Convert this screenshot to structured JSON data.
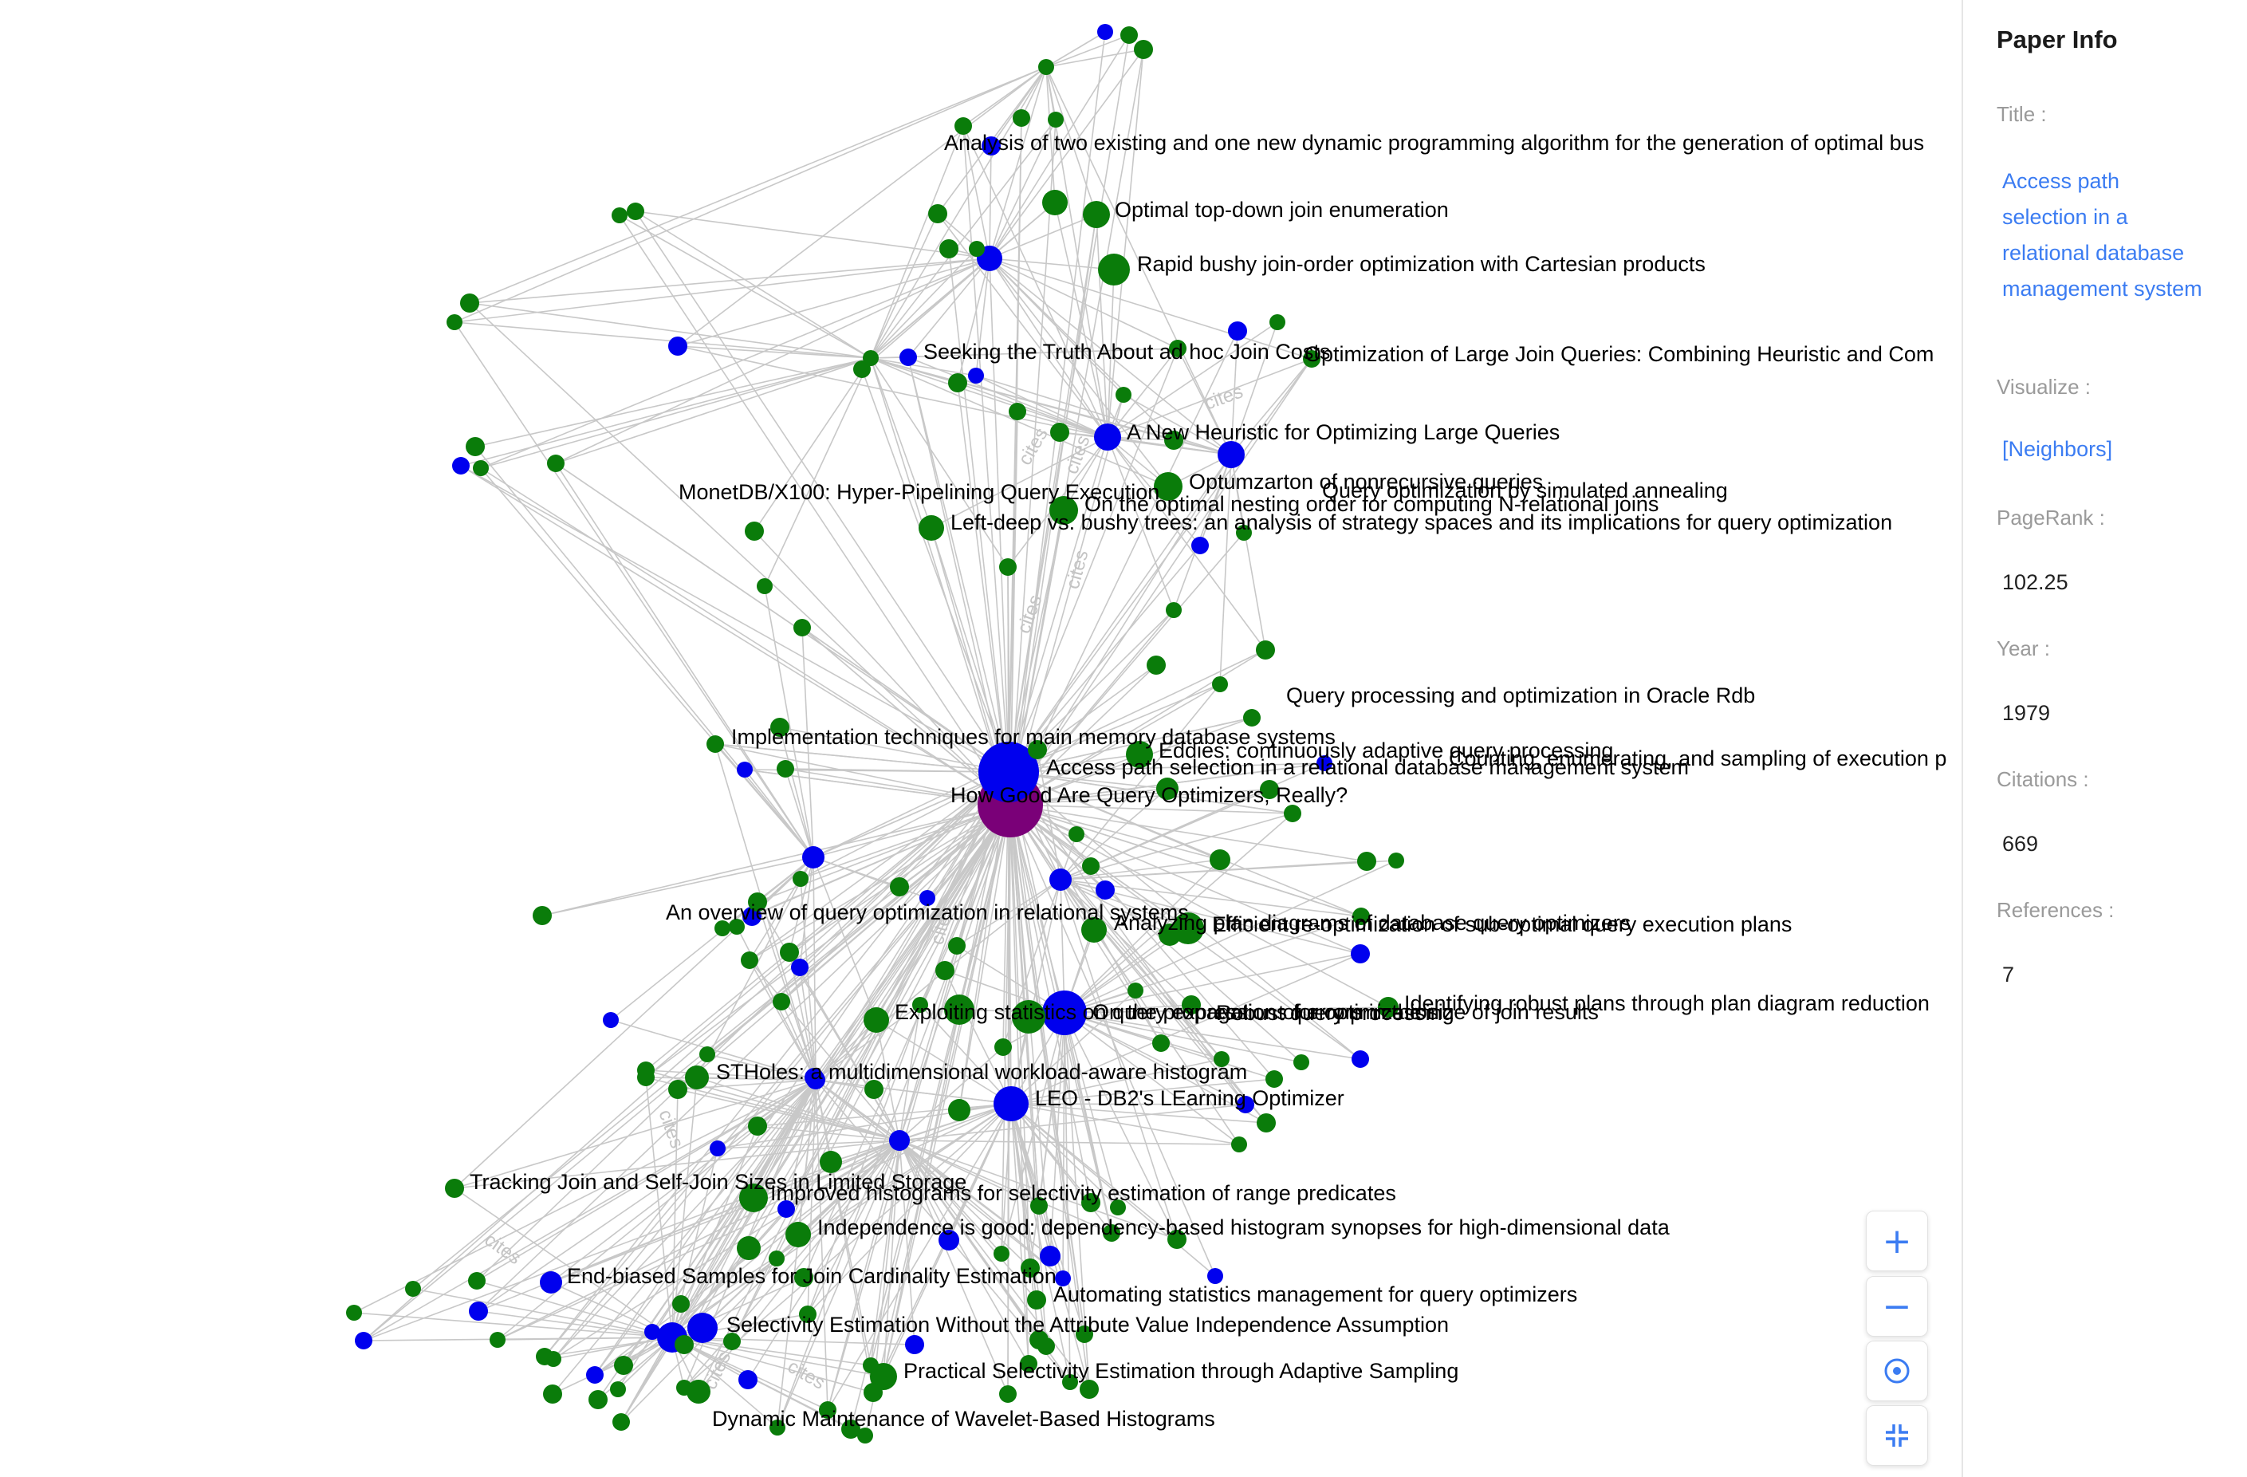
{
  "panel": {
    "title": "Paper Info",
    "title_label": "Title :",
    "paper_title": "Access path selection in a relational database management system",
    "visualize_label": "Visualize :",
    "visualize_link": "[Neighbors]",
    "pagerank_label": "PageRank :",
    "pagerank_value": "102.25",
    "year_label": "Year :",
    "year_value": "1979",
    "citations_label": "Citations :",
    "citations_value": "669",
    "references_label": "References :",
    "references_value": "7"
  },
  "controls": {
    "zoom_in": "+",
    "zoom_out": "−",
    "center": "⊙",
    "collapse": "⤡"
  },
  "colors": {
    "green": "#0a7c0a",
    "blue": "#0000ee",
    "purple": "#7a0078",
    "edge": "#c8c8c8",
    "accent": "#3b7cf2"
  },
  "edge_label_text": "cites",
  "labels": {
    "l1": "Analysis of two existing and one new dynamic programming algorithm for the generation of optimal bus",
    "l2": "Optimal top-down join enumeration",
    "l3": "Rapid bushy join-order optimization with Cartesian products",
    "l4": "Seeking the Truth About ad hoc Join Costs",
    "l5": "Optimization of Large Join Queries: Combining Heuristic and Com",
    "l6": "A New Heuristic for Optimizing Large Queries",
    "l7": "Optumzarton of nonrecursive queries",
    "l8": "Query optimization by simulated annealing",
    "l9": "MonetDB/X100: Hyper-Pipelining Query Execution",
    "l10": "On the optimal nesting order for computing N-relational joins",
    "l11": "Left-deep vs. bushy trees: an analysis of strategy spaces and its implications for query optimization",
    "l12": "Query processing and optimization in Oracle Rdb",
    "l13": "Implementation techniques for main memory database systems",
    "l14": "Eddies: continuously adaptive query processing",
    "l15": "Counting, enumerating, and sampling of execution p",
    "l16": "Access path selection in a relational database management system",
    "l17": "How Good Are Query Optimizers, Really?",
    "l18": "An overview of query optimization in relational systems",
    "l19": "Analyzing plan diagrams of database query optimizers",
    "l20": "Efficient re-optimization of sub-optimal query execution plans",
    "l21": "Identifying robust plans through plan diagram reduction",
    "l22": "Exploiting statistics on query expressions for optimization",
    "l23": "On the propagation of errors in the size of join results",
    "l24": "Robust query processing",
    "l25": "STHoles: a multidimensional workload-aware histogram",
    "l26": "LEO - DB2's LEarning Optimizer",
    "l27": "Tracking Join and Self-Join Sizes in Limited Storage",
    "l28": "Improved histograms for selectivity estimation of range predicates",
    "l29": "Independence is good: dependency-based histogram synopses for high-dimensional data",
    "l30": "End-biased Samples for Join Cardinality Estimation",
    "l31": "Automating statistics management for query optimizers",
    "l32": "Selectivity Estimation Without the Attribute Value Independence Assumption",
    "l33": "Practical Selectivity Estimation through Adaptive Sampling",
    "l34": "Dynamic Maintenance of Wavelet-Based Histograms"
  }
}
